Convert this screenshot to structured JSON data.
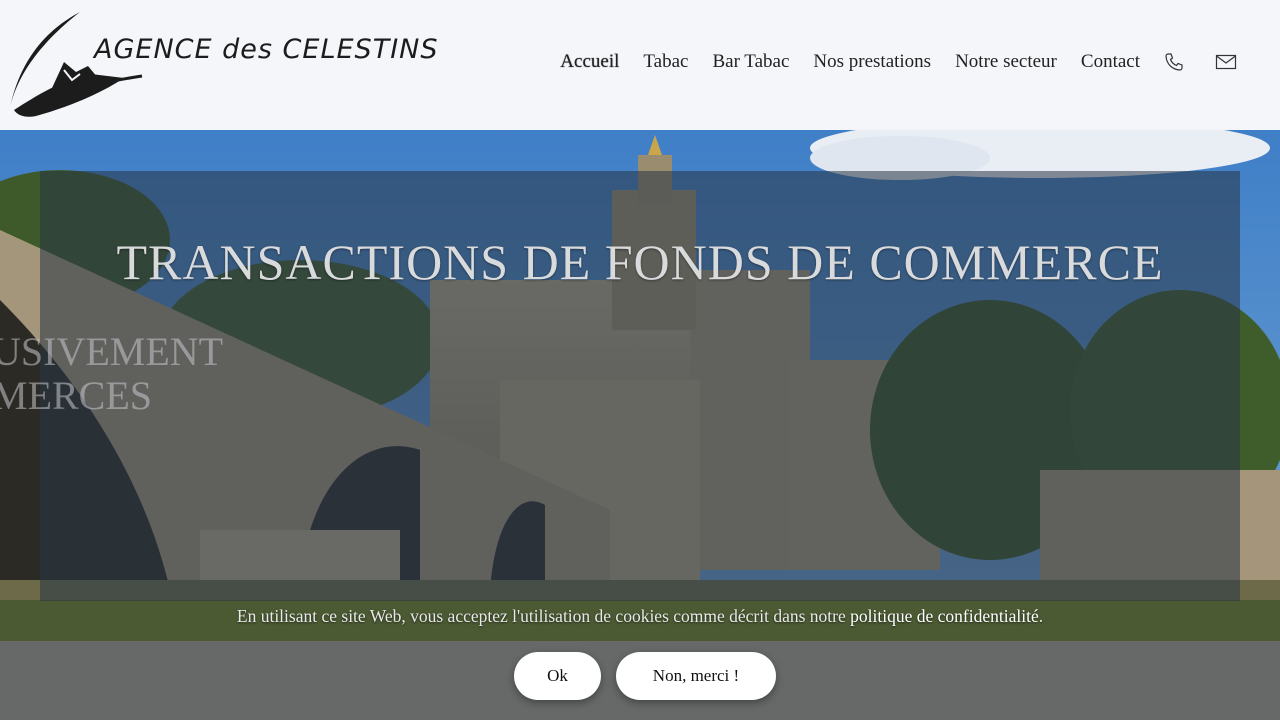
{
  "brand": {
    "name": "AGENCE des CELESTINS"
  },
  "nav": {
    "items": [
      {
        "label": "Accueil",
        "active": true
      },
      {
        "label": "Tabac"
      },
      {
        "label": "Bar Tabac"
      },
      {
        "label": "Nos prestations"
      },
      {
        "label": "Notre secteur"
      },
      {
        "label": "Contact"
      }
    ],
    "icons": [
      "phone-icon",
      "mail-icon"
    ]
  },
  "hero": {
    "title": "TRANSACTIONS DE FONDS DE COMMERCE",
    "partial_line_1": "USIVEMENT",
    "partial_line_2": "MERCES"
  },
  "cookie": {
    "text_before": "En utilisant ce site Web, vous acceptez l'utilisation de cookies comme décrit dans notre ",
    "link": "politique de confidentialité",
    "text_after": ".",
    "ok_label": "Ok",
    "decline_label": "Non, merci !"
  },
  "colors": {
    "header_bg": "#f5f6fa",
    "overlay": "rgba(40,52,70,0.55)",
    "cookie_bar": "#696a6e"
  }
}
